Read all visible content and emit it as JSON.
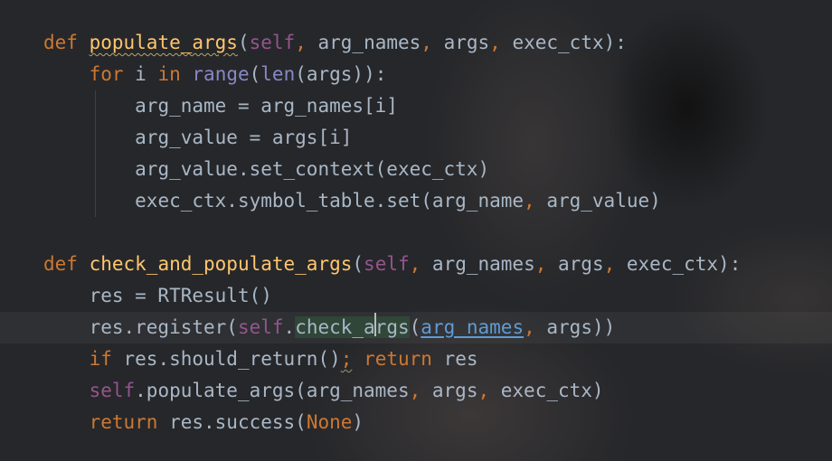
{
  "code": {
    "l1": {
      "def": "def",
      "name": "populate_args",
      "open": "(",
      "self": "self",
      "c1": ",",
      "a1": " arg_names",
      "c2": ",",
      "a2": " args",
      "c3": ",",
      "a3": " exec_ctx",
      "close": "):"
    },
    "l2": {
      "for": "for",
      "i": " i ",
      "in": "in",
      "sp": " ",
      "range": "range",
      "p1": "(",
      "len": "len",
      "rest": "(args)):"
    },
    "l3": {
      "text": "arg_name = arg_names[i]"
    },
    "l4": {
      "text": "arg_value = args[i]"
    },
    "l5": {
      "text": "arg_value.set_context(exec_ctx)"
    },
    "l6": {
      "pre": "exec_ctx.symbol_table.set(arg_name",
      "comma": ",",
      "post": " arg_value)"
    },
    "l8": {
      "def": "def",
      "name": "check_and_populate_args",
      "open": "(",
      "self": "self",
      "c1": ",",
      "a1": " arg_names",
      "c2": ",",
      "a2": " args",
      "c3": ",",
      "a3": " exec_ctx",
      "close": "):"
    },
    "l9": {
      "text": "res = RTResult()"
    },
    "l10": {
      "pre": "res.register(",
      "self": "self",
      "dot": ".",
      "m_a": "check_a",
      "m_b": "rgs",
      "open": "(",
      "param": "arg_names",
      "comma": ",",
      "post": " args))"
    },
    "l11": {
      "if": "if",
      "mid": " res.should_return()",
      "semi": ";",
      "sp": " ",
      "return": "return",
      "post": " res"
    },
    "l12": {
      "self": "self",
      "mid": ".populate_args(arg_names",
      "c1": ",",
      "a2": " args",
      "c2": ",",
      "post": " exec_ctx)"
    },
    "l13": {
      "return": "return",
      "mid": " res.success(",
      "none": "None",
      "close": ")"
    }
  },
  "colors": {
    "keyword": "#cc7832",
    "function": "#ffc66d",
    "self": "#94558d",
    "builtin": "#8888c6",
    "text": "#a9b7c6",
    "param_link": "#5f9bd6"
  }
}
